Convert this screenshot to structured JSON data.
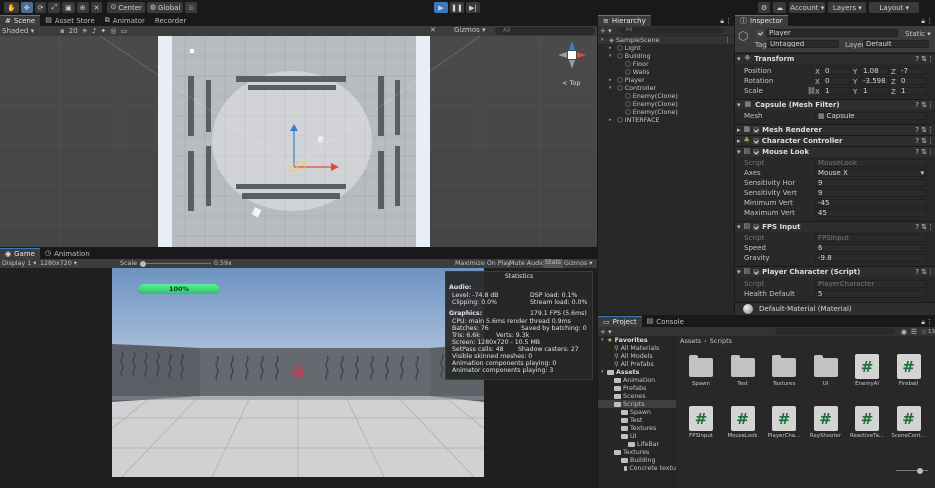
{
  "toolbar": {
    "pivot": "Center",
    "space": "Global",
    "account": "Account",
    "layers": "Layers",
    "layout": "Layout"
  },
  "scene_panel": {
    "tabs": [
      "Scene",
      "Asset Store",
      "Animator",
      "Recorder"
    ],
    "shading": "Shaded",
    "grid_value": "20",
    "gizmos": "Gizmos",
    "search": "All",
    "gizmo_label": "< Top"
  },
  "game_panel": {
    "tabs": [
      "Game",
      "Animation"
    ],
    "display": "Display 1",
    "resolution": "1280x720",
    "scale_label": "Scale",
    "scale_value": "0.59x",
    "maximize": "Maximize On Play",
    "mute": "Mute Audio",
    "stats": "Stats",
    "gizmos": "Gizmos",
    "health_text": "100%",
    "health_fraction": 1.0
  },
  "stats": {
    "title": "Statistics",
    "audio_header": "Audio:",
    "level": "Level: -74.8 dB",
    "clipping": "Clipping: 0.0%",
    "dsp": "DSP load: 0.1%",
    "stream": "Stream load: 0.0%",
    "graphics_header": "Graphics:",
    "fps": "179.1 FPS (5.6ms)",
    "cpu": "CPU: main 5.6ms  render thread 0.9ms",
    "batches": "Batches: 76",
    "saved": "Saved by batching: 0",
    "tris": "Tris: 6.6k",
    "verts": "Verts: 9.3k",
    "screen": "Screen: 1280x720 - 10.5 MB",
    "setpass": "SetPass calls: 48",
    "shadow": "Shadow casters: 27",
    "skinned": "Visible skinned meshes: 0",
    "anim": "Animation components playing: 0",
    "animator": "Animator components playing: 3"
  },
  "hierarchy": {
    "tab": "Hierarchy",
    "search": "All",
    "items": [
      {
        "label": "SampleScene",
        "indent": 0
      },
      {
        "label": "Light",
        "indent": 1
      },
      {
        "label": "Building",
        "indent": 1
      },
      {
        "label": "Floor",
        "indent": 2
      },
      {
        "label": "Walls",
        "indent": 2
      },
      {
        "label": "Player",
        "indent": 1
      },
      {
        "label": "Controller",
        "indent": 1
      },
      {
        "label": "Enemy(Clone)",
        "indent": 2
      },
      {
        "label": "Enemy(Clone)",
        "indent": 2
      },
      {
        "label": "Enemy(Clone)",
        "indent": 2
      },
      {
        "label": "INTERFACE",
        "indent": 1
      }
    ]
  },
  "inspector": {
    "tab": "Inspector",
    "object_name": "Player",
    "static": "Static",
    "tag_label": "Tag",
    "tag": "Untagged",
    "layer_label": "Layer",
    "layer": "Default",
    "transform": {
      "title": "Transform",
      "position_label": "Position",
      "rotation_label": "Rotation",
      "scale_label": "Scale",
      "position": [
        "0",
        "1.08",
        "-7"
      ],
      "rotation": [
        "0",
        "-3.598",
        "0"
      ],
      "scale": [
        "1",
        "1",
        "1"
      ]
    },
    "mesh_filter": {
      "title": "Capsule (Mesh Filter)",
      "mesh_label": "Mesh",
      "mesh": "Capsule"
    },
    "mesh_renderer": "Mesh Renderer",
    "char_controller": "Character Controller",
    "mouse_look": {
      "title": "Mouse Look",
      "script_label": "Script",
      "script": "MouseLook",
      "axes_label": "Axes",
      "axes": "Mouse X",
      "sens_hor_label": "Sensitivity Hor",
      "sens_hor": "9",
      "sens_vert_label": "Sensitivity Vert",
      "sens_vert": "9",
      "min_vert_label": "Minimum Vert",
      "min_vert": "-45",
      "max_vert_label": "Maximum Vert",
      "max_vert": "45"
    },
    "fps_input": {
      "title": "FPS Input",
      "script_label": "Script",
      "script": "FPSInput",
      "speed_label": "Speed",
      "speed": "6",
      "gravity_label": "Gravity",
      "gravity": "-9.8"
    },
    "player_character": {
      "title": "Player Character (Script)",
      "script_label": "Script",
      "script": "PlayerCharacter",
      "health_label": "Health Default",
      "health": "5"
    },
    "material": "Default-Material (Material)"
  },
  "project": {
    "tabs": [
      "Project",
      "Console"
    ],
    "breadcrumb": [
      "Assets",
      "Scripts"
    ],
    "slider_value": "13",
    "tree": [
      {
        "label": "Favorites",
        "indent": 0,
        "bold": true
      },
      {
        "label": "All Materials",
        "indent": 1
      },
      {
        "label": "All Models",
        "indent": 1
      },
      {
        "label": "All Prefabs",
        "indent": 1
      },
      {
        "label": "Assets",
        "indent": 0,
        "bold": true
      },
      {
        "label": "Animation",
        "indent": 1
      },
      {
        "label": "Prefabs",
        "indent": 1
      },
      {
        "label": "Scenes",
        "indent": 1
      },
      {
        "label": "Scripts",
        "indent": 1,
        "selected": true
      },
      {
        "label": "Spawn",
        "indent": 2
      },
      {
        "label": "Test",
        "indent": 2
      },
      {
        "label": "Textures",
        "indent": 2
      },
      {
        "label": "UI",
        "indent": 2
      },
      {
        "label": "LifeBar",
        "indent": 3
      },
      {
        "label": "Textures",
        "indent": 1
      },
      {
        "label": "Building",
        "indent": 2
      },
      {
        "label": "Concrete textu",
        "indent": 3
      }
    ],
    "assets": [
      {
        "label": "Spawn",
        "type": "folder"
      },
      {
        "label": "Test",
        "type": "folder"
      },
      {
        "label": "Textures",
        "type": "folder"
      },
      {
        "label": "UI",
        "type": "folder"
      },
      {
        "label": "EnemyAI",
        "type": "script"
      },
      {
        "label": "Fireball",
        "type": "script"
      },
      {
        "label": "FPSInput",
        "type": "script"
      },
      {
        "label": "MouseLook",
        "type": "script"
      },
      {
        "label": "PlayerCha...",
        "type": "script"
      },
      {
        "label": "RayShooter",
        "type": "script"
      },
      {
        "label": "ReactiveTa...",
        "type": "script"
      },
      {
        "label": "SceneCont...",
        "type": "script"
      }
    ]
  }
}
